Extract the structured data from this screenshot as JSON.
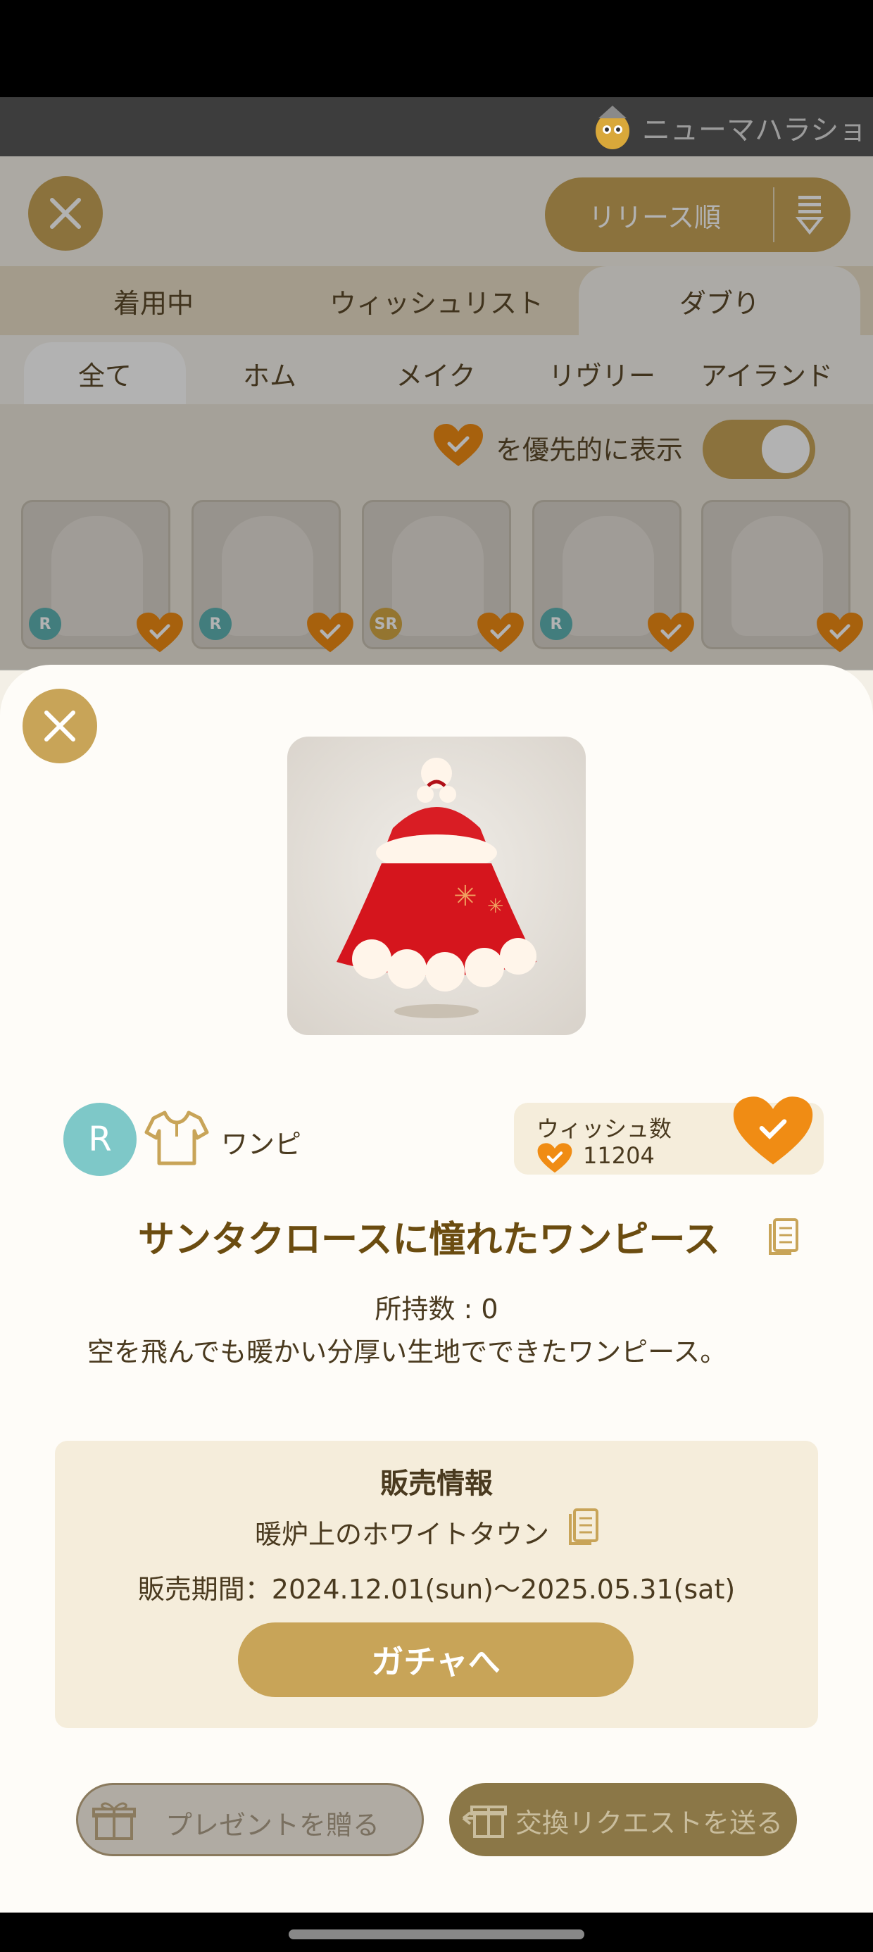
{
  "app": {
    "title": "ニューマハラショ"
  },
  "toolbar": {
    "sort_label": "リリース順"
  },
  "tabs_main": [
    {
      "label": "着用中",
      "active": false
    },
    {
      "label": "ウィッシュリスト",
      "active": false
    },
    {
      "label": "ダブり",
      "active": true
    }
  ],
  "tabs_sub": [
    {
      "label": "全て",
      "active": true
    },
    {
      "label": "ホム",
      "active": false
    },
    {
      "label": "メイク",
      "active": false
    },
    {
      "label": "リヴリー",
      "active": false
    },
    {
      "label": "アイランド",
      "active": false
    }
  ],
  "filter": {
    "prioritize_label": "を優先的に表示",
    "toggle_on": true
  },
  "grid": [
    {
      "rarity": "R"
    },
    {
      "rarity": "R"
    },
    {
      "rarity": "SR"
    },
    {
      "rarity": "R"
    },
    {
      "rarity": ""
    }
  ],
  "item": {
    "rarity": "R",
    "category": "ワンピ",
    "category_icon": "shirt-icon",
    "wish_title": "ウィッシュ数",
    "wish_count": "11204",
    "name": "サンタクロースに憧れたワンピース",
    "owned": "所持数 : 0",
    "description": "空を飛んでも暖かい分厚い生地でできたワンピース。"
  },
  "sales": {
    "title": "販売情報",
    "gacha_name": "暖炉上のホワイトタウン",
    "period": "販売期間：2024.12.01(sun)〜2025.05.31(sat)",
    "gacha_button": "ガチャへ"
  },
  "actions": {
    "present_label": "プレゼントを贈る",
    "trade_label": "交換リクエストを送る"
  },
  "colors": {
    "accent_gold": "#c8a458",
    "heart_orange": "#f08c14",
    "rarity_teal": "#7ec8c8",
    "text_brown": "#4a3a1f"
  }
}
